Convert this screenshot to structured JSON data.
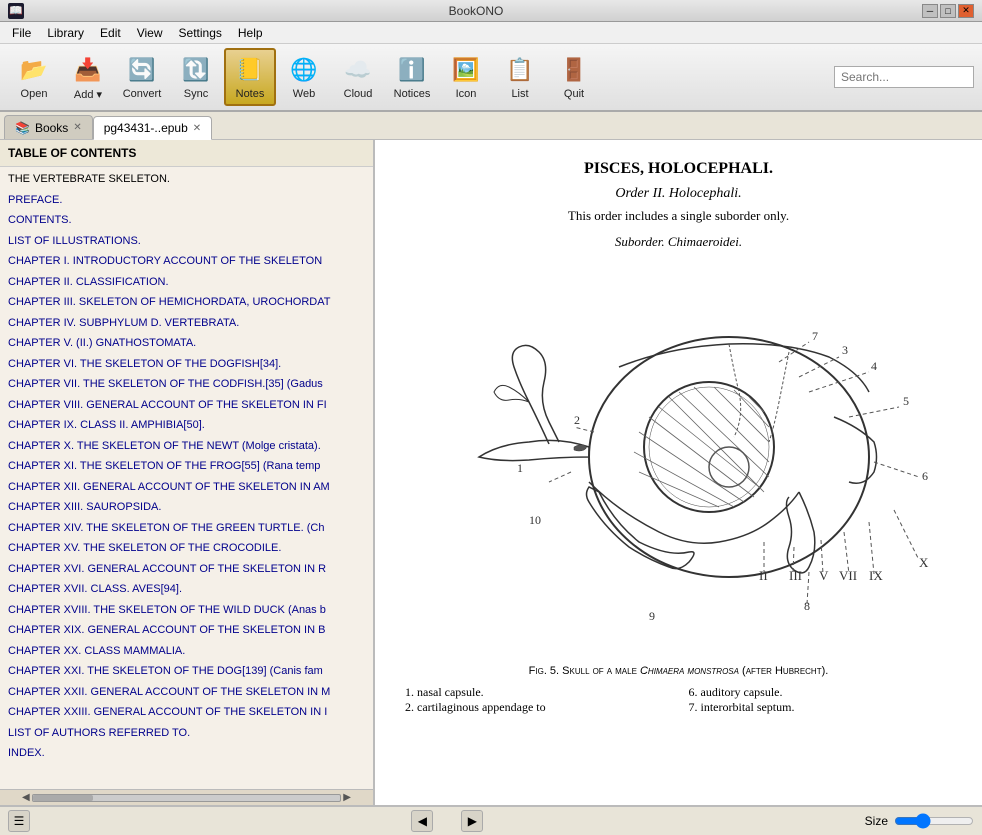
{
  "app": {
    "title": "BookONO",
    "icon": "📖"
  },
  "window": {
    "minimize": "─",
    "maximize": "□",
    "close": "✕"
  },
  "menubar": {
    "items": [
      "File",
      "Library",
      "Edit",
      "View",
      "Settings",
      "Help"
    ]
  },
  "toolbar": {
    "buttons": [
      {
        "id": "open",
        "label": "Open",
        "icon": "📂",
        "active": false
      },
      {
        "id": "add",
        "label": "Add ▾",
        "icon": "📥",
        "active": false
      },
      {
        "id": "convert",
        "label": "Convert",
        "icon": "🔄",
        "active": false
      },
      {
        "id": "sync",
        "label": "Sync",
        "icon": "🔃",
        "active": false
      },
      {
        "id": "notes",
        "label": "Notes",
        "icon": "📒",
        "active": true
      },
      {
        "id": "web",
        "label": "Web",
        "icon": "🌐",
        "active": false
      },
      {
        "id": "cloud",
        "label": "Cloud",
        "icon": "☁️",
        "active": false
      },
      {
        "id": "notices",
        "label": "Notices",
        "icon": "ℹ️",
        "active": false
      },
      {
        "id": "icon",
        "label": "Icon",
        "icon": "🖼️",
        "active": false
      },
      {
        "id": "list",
        "label": "List",
        "icon": "📋",
        "active": false
      },
      {
        "id": "quit",
        "label": "Quit",
        "icon": "🚪",
        "active": false
      }
    ],
    "search_placeholder": "Search..."
  },
  "tabs": [
    {
      "id": "books",
      "label": "Books",
      "active": false,
      "closeable": true
    },
    {
      "id": "pg43431",
      "label": "pg43431-..epub",
      "active": true,
      "closeable": true
    }
  ],
  "toc": {
    "header": "TABLE OF CONTENTS",
    "items": [
      {
        "text": "THE VERTEBRATE SKELETON.",
        "type": "plain"
      },
      {
        "text": "PREFACE.",
        "type": "link"
      },
      {
        "text": "CONTENTS.",
        "type": "link"
      },
      {
        "text": "LIST OF ILLUSTRATIONS.",
        "type": "link"
      },
      {
        "text": "CHAPTER I. INTRODUCTORY ACCOUNT OF THE SKELETON",
        "type": "link"
      },
      {
        "text": "CHAPTER II. CLASSIFICATION.",
        "type": "link"
      },
      {
        "text": "CHAPTER III. SKELETON OF HEMICHORDATA, UROCHORDAT",
        "type": "link"
      },
      {
        "text": "CHAPTER IV. SUBPHYLUM D. VERTEBRATA.",
        "type": "link"
      },
      {
        "text": "CHAPTER V. (II.) GNATHOSTOMATA.",
        "type": "link"
      },
      {
        "text": "CHAPTER VI. THE SKELETON OF THE DOGFISH[34].",
        "type": "link"
      },
      {
        "text": "CHAPTER VII. THE SKELETON OF THE CODFISH.[35] (Gadus",
        "type": "link"
      },
      {
        "text": "CHAPTER VIII. GENERAL ACCOUNT OF THE SKELETON IN FI",
        "type": "link"
      },
      {
        "text": "CHAPTER IX. CLASS II. AMPHIBIA[50].",
        "type": "link"
      },
      {
        "text": "CHAPTER X. THE SKELETON OF THE NEWT (Molge cristata).",
        "type": "link"
      },
      {
        "text": "CHAPTER XI. THE SKELETON OF THE FROG[55] (Rana temp",
        "type": "link"
      },
      {
        "text": "CHAPTER XII. GENERAL ACCOUNT OF THE SKELETON IN AM",
        "type": "link"
      },
      {
        "text": "CHAPTER XIII. SAUROPSIDA.",
        "type": "link"
      },
      {
        "text": "CHAPTER XIV. THE SKELETON OF THE GREEN TURTLE. (Ch",
        "type": "link"
      },
      {
        "text": "CHAPTER XV. THE SKELETON OF THE CROCODILE.",
        "type": "link"
      },
      {
        "text": "CHAPTER XVI. GENERAL ACCOUNT OF THE SKELETON IN R",
        "type": "link"
      },
      {
        "text": "CHAPTER XVII. CLASS. AVES[94].",
        "type": "link"
      },
      {
        "text": "CHAPTER XVIII. THE SKELETON OF THE WILD DUCK (Anas b",
        "type": "link"
      },
      {
        "text": "CHAPTER XIX. GENERAL ACCOUNT OF THE SKELETON IN B",
        "type": "link"
      },
      {
        "text": "CHAPTER XX. CLASS MAMMALIA.",
        "type": "link"
      },
      {
        "text": "CHAPTER XXI. THE SKELETON OF THE DOG[139] (Canis fam",
        "type": "link"
      },
      {
        "text": "CHAPTER XXII. GENERAL ACCOUNT OF THE SKELETON IN M",
        "type": "link"
      },
      {
        "text": "CHAPTER XXIII. GENERAL ACCOUNT OF THE SKELETON IN I",
        "type": "link"
      },
      {
        "text": "LIST OF AUTHORS REFERRED TO.",
        "type": "link"
      },
      {
        "text": "INDEX.",
        "type": "link"
      }
    ]
  },
  "content": {
    "title": "PISCES, HOLOCEPHALI.",
    "subtitle": "Order II. Holocephali.",
    "order_text": "This order includes a single suborder only.",
    "suborder": "Suborder. Chimaeroidei.",
    "figure_caption": "Fig. 5. Skull of a male Chimaera monstrosa (after Hubrecht).",
    "figure_caption_italic": "Chimaera monstrosa",
    "notes": [
      "1. nasal capsule.",
      "2. cartilaginous appendage to",
      "6. auditory capsule.",
      "7. interorbital septum."
    ]
  },
  "statusbar": {
    "size_label": "Size"
  }
}
